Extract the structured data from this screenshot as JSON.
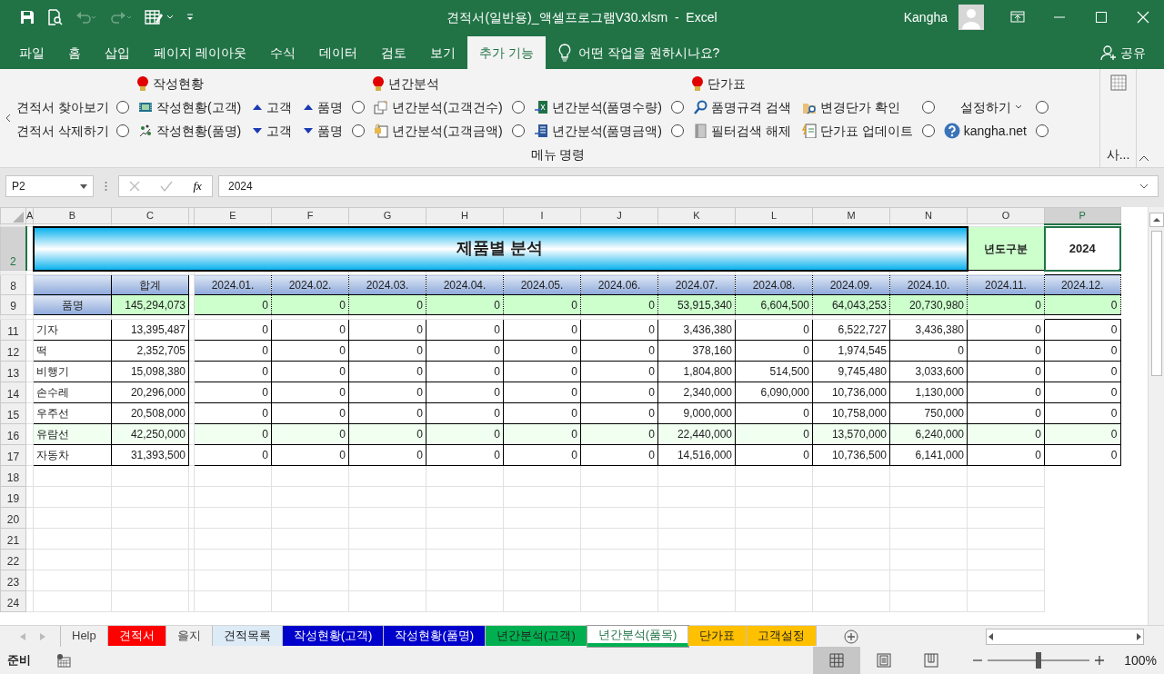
{
  "window": {
    "title": "견적서(일반용)_액셀프로그램V30.xlsm  -  Excel",
    "user": "Kangha"
  },
  "ribbon_tabs": [
    {
      "label": "파일",
      "selected": false
    },
    {
      "label": "홈",
      "selected": false
    },
    {
      "label": "삽입",
      "selected": false
    },
    {
      "label": "페이지 레이아웃",
      "selected": false
    },
    {
      "label": "수식",
      "selected": false
    },
    {
      "label": "데이터",
      "selected": false
    },
    {
      "label": "검토",
      "selected": false
    },
    {
      "label": "보기",
      "selected": false
    },
    {
      "label": "추가 기능",
      "selected": true
    }
  ],
  "tell_me": "어떤 작업을 원하시나요?",
  "share": "공유",
  "ribbon": {
    "group_label": "메뉴 명령",
    "more_label": "사...",
    "columns": [
      {
        "items": [
          {
            "kind": "label",
            "text": "견적서 찾아보기"
          },
          {
            "kind": "label",
            "text": "견적서 삭제하기"
          }
        ]
      },
      {
        "items": [
          {
            "kind": "radio",
            "checked": false
          },
          {
            "kind": "radio",
            "checked": false
          }
        ]
      },
      {
        "heading": "작성현황",
        "items": [
          {
            "kind": "tool",
            "text": "작성현황(고객)"
          },
          {
            "kind": "tool",
            "text": "작성현황(품명)"
          }
        ]
      },
      {
        "items": [
          {
            "kind": "up",
            "text": "고객"
          },
          {
            "kind": "down",
            "text": "고객"
          }
        ]
      },
      {
        "items": [
          {
            "kind": "up",
            "text": "품명"
          },
          {
            "kind": "down",
            "text": "품명"
          }
        ]
      },
      {
        "items": [
          {
            "kind": "radio",
            "checked": false
          },
          {
            "kind": "radio",
            "checked": false
          }
        ]
      },
      {
        "heading": "년간분석",
        "items": [
          {
            "kind": "tool",
            "text": "년간분석(고객건수)"
          },
          {
            "kind": "tool",
            "text": "년간분석(고객금액)"
          }
        ]
      },
      {
        "items": [
          {
            "kind": "radio",
            "checked": false
          },
          {
            "kind": "radio",
            "checked": false
          }
        ]
      },
      {
        "items": [
          {
            "kind": "tool",
            "text": "년간분석(품명수량)"
          },
          {
            "kind": "tool",
            "text": "년간분석(품명금액)"
          }
        ]
      },
      {
        "items": [
          {
            "kind": "radio",
            "checked": false
          },
          {
            "kind": "radio",
            "checked": false
          }
        ]
      },
      {
        "heading": "단가표",
        "items": [
          {
            "kind": "tool",
            "text": "품명규격 검색"
          },
          {
            "kind": "tool",
            "text": "필터검색 해제"
          }
        ]
      },
      {
        "items": [
          {
            "kind": "tool",
            "text": "변경단가 확인"
          },
          {
            "kind": "tool",
            "text": "단가표 업데이트"
          }
        ]
      },
      {
        "items": [
          {
            "kind": "radio",
            "checked": false
          },
          {
            "kind": "radio",
            "checked": false
          }
        ]
      },
      {
        "items": [
          {
            "kind": "dropdown",
            "text": "설정하기"
          },
          {
            "kind": "help",
            "text": "kangha.net"
          }
        ]
      },
      {
        "items": [
          {
            "kind": "radio",
            "checked": false
          },
          {
            "kind": "radio",
            "checked": false
          }
        ]
      }
    ]
  },
  "formula_bar": {
    "name_box": "P2",
    "function_label": "fx",
    "value": "2024"
  },
  "sheet": {
    "columns": [
      {
        "label": "A",
        "selected": false
      },
      {
        "label": "B",
        "selected": false
      },
      {
        "label": "C",
        "selected": false
      },
      {
        "selected": false
      },
      {
        "label": "E",
        "selected": false
      },
      {
        "label": "F",
        "selected": false
      },
      {
        "label": "G",
        "selected": false
      },
      {
        "label": "H",
        "selected": false
      },
      {
        "label": "I",
        "selected": false
      },
      {
        "label": "J",
        "selected": false
      },
      {
        "label": "K",
        "selected": false
      },
      {
        "label": "L",
        "selected": false
      },
      {
        "label": "M",
        "selected": false
      },
      {
        "label": "N",
        "selected": false
      },
      {
        "label": "O",
        "selected": false
      },
      {
        "label": "P",
        "selected": true
      }
    ],
    "rows": [
      {
        "number": "2",
        "kind": "banner",
        "selected": true,
        "title": "제품별 분석",
        "label": "년도구분",
        "value": "2024"
      },
      {
        "number": "8",
        "kind": "header",
        "selected": false,
        "total_label": "합계",
        "months": [
          "2024.01.",
          "2024.02.",
          "2024.03.",
          "2024.04.",
          "2024.05.",
          "2024.06.",
          "2024.07.",
          "2024.08.",
          "2024.09.",
          "2024.10.",
          "2024.11.",
          "2024.12."
        ]
      },
      {
        "number": "9",
        "kind": "sum",
        "selected": false,
        "name": "품명",
        "total": "145,294,073",
        "values": [
          "0",
          "0",
          "0",
          "0",
          "0",
          "0",
          "53,915,340",
          "6,604,500",
          "64,043,253",
          "20,730,980",
          "0",
          "0"
        ]
      },
      {
        "number": "11",
        "kind": "item",
        "selected": false,
        "highlighted": false,
        "name": "기자",
        "total": "13,395,487",
        "values": [
          "0",
          "0",
          "0",
          "0",
          "0",
          "0",
          "3,436,380",
          "0",
          "6,522,727",
          "3,436,380",
          "0",
          "0"
        ]
      },
      {
        "number": "12",
        "kind": "item",
        "selected": false,
        "highlighted": false,
        "name": "떡",
        "total": "2,352,705",
        "values": [
          "0",
          "0",
          "0",
          "0",
          "0",
          "0",
          "378,160",
          "0",
          "1,974,545",
          "0",
          "0",
          "0"
        ]
      },
      {
        "number": "13",
        "kind": "item",
        "selected": false,
        "highlighted": false,
        "name": "비행기",
        "total": "15,098,380",
        "values": [
          "0",
          "0",
          "0",
          "0",
          "0",
          "0",
          "1,804,800",
          "514,500",
          "9,745,480",
          "3,033,600",
          "0",
          "0"
        ]
      },
      {
        "number": "14",
        "kind": "item",
        "selected": false,
        "highlighted": false,
        "name": "손수레",
        "total": "20,296,000",
        "values": [
          "0",
          "0",
          "0",
          "0",
          "0",
          "0",
          "2,340,000",
          "6,090,000",
          "10,736,000",
          "1,130,000",
          "0",
          "0"
        ]
      },
      {
        "number": "15",
        "kind": "item",
        "selected": false,
        "highlighted": false,
        "name": "우주선",
        "total": "20,508,000",
        "values": [
          "0",
          "0",
          "0",
          "0",
          "0",
          "0",
          "9,000,000",
          "0",
          "10,758,000",
          "750,000",
          "0",
          "0"
        ]
      },
      {
        "number": "16",
        "kind": "item",
        "selected": false,
        "highlighted": true,
        "name": "유람선",
        "total": "42,250,000",
        "values": [
          "0",
          "0",
          "0",
          "0",
          "0",
          "0",
          "22,440,000",
          "0",
          "13,570,000",
          "6,240,000",
          "0",
          "0"
        ]
      },
      {
        "number": "17",
        "kind": "item",
        "selected": false,
        "highlighted": false,
        "name": "자동차",
        "total": "31,393,500",
        "values": [
          "0",
          "0",
          "0",
          "0",
          "0",
          "0",
          "14,516,000",
          "0",
          "10,736,500",
          "6,141,000",
          "0",
          "0"
        ]
      },
      {
        "number": "18",
        "kind": "empty",
        "selected": false
      },
      {
        "number": "19",
        "kind": "empty",
        "selected": false
      },
      {
        "number": "20",
        "kind": "empty",
        "selected": false
      },
      {
        "number": "21",
        "kind": "empty",
        "selected": false
      },
      {
        "number": "22",
        "kind": "empty",
        "selected": false
      },
      {
        "number": "23",
        "kind": "empty",
        "selected": false
      },
      {
        "number": "24",
        "kind": "empty",
        "selected": false
      }
    ]
  },
  "sheet_tabs": [
    {
      "label": "Help",
      "selected": false
    },
    {
      "label": "견적서",
      "color": "#ff0000",
      "selected": false
    },
    {
      "label": "을지",
      "selected": false
    },
    {
      "label": "견적목록",
      "color": "#ddebf7",
      "selected": false
    },
    {
      "label": "작성현황(고객)",
      "color": "#0000cc",
      "selected": false
    },
    {
      "label": "작성현황(품명)",
      "color": "#0000cc",
      "selected": false
    },
    {
      "label": "년간분석(고객)",
      "color": "#00b050",
      "selected": false
    },
    {
      "label": "년간분석(품목)",
      "color": "#00b050",
      "selected": true
    },
    {
      "label": "단가표",
      "color": "#ffc000",
      "selected": false
    },
    {
      "label": "고객설정",
      "color": "#ffc000",
      "selected": false
    }
  ],
  "status_bar": {
    "text": "준비",
    "views": [
      {
        "selected": true
      },
      {
        "selected": false
      },
      {
        "selected": false
      }
    ],
    "zoom": {
      "level": 0.5,
      "label": "100%"
    }
  }
}
